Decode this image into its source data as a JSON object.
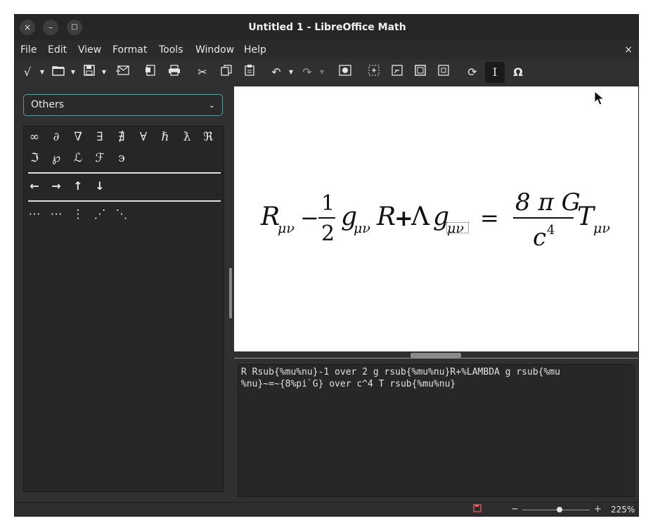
{
  "window": {
    "title": "Untitled 1 - LibreOffice Math",
    "close_glyph": "×",
    "minimize_glyph": "–",
    "maximize_glyph": "□"
  },
  "menubar": {
    "items": [
      "File",
      "Edit",
      "View",
      "Format",
      "Tools",
      "Window",
      "Help"
    ],
    "close_glyph": "×"
  },
  "toolbar": {
    "icons": [
      "formula-cursor-icon",
      "open-icon",
      "save-icon",
      "export-icon",
      "export-pdf-icon",
      "print-icon",
      "cut-icon",
      "copy-icon",
      "paste-icon",
      "undo-icon",
      "redo-icon",
      "zoom-100-icon",
      "zoom-in-icon",
      "zoom-out-icon",
      "show-all-icon",
      "shrink-icon",
      "update-icon",
      "formula-cursor-toggle-icon",
      "symbols-icon"
    ]
  },
  "elements_panel": {
    "category": "Others",
    "others_row1": [
      "∞",
      "∂",
      "∇",
      "∃",
      "∄",
      "∀",
      "ℏ",
      "ƛ",
      "ℜ"
    ],
    "others_row2": [
      "ℑ",
      "℘",
      "ℒ",
      "ℱ",
      "϶"
    ],
    "arrows": [
      "←",
      "→",
      "↑",
      "↓"
    ],
    "dots": [
      "⋯",
      "⋯",
      "⋮",
      "⋰",
      "⋱"
    ]
  },
  "formula_preview": {
    "R": "R",
    "sub_mu_nu": "μν",
    "minus": "−",
    "one": "1",
    "two": "2",
    "g": "g",
    "plus": "+",
    "lambda": "Λ",
    "equals": "=",
    "eight_pi_g": "8 π G",
    "c": "c",
    "four": "4",
    "T": "T"
  },
  "editor": {
    "line1": "R Rsub{%mu%nu}-1 over 2 g rsub{%mu%nu}R+%LAMBDA g rsub{%mu",
    "line2": "%nu}~=~{8%pi`G} over c^4 T rsub{%mu%nu}"
  },
  "statusbar": {
    "zoom_minus": "−",
    "zoom_plus": "+",
    "zoom_label": "225%",
    "zoom_level": 0.55
  },
  "colors": {
    "window_bg": "#303030",
    "titlebar_bg": "#262626",
    "dropdown_border": "#5a9a9a",
    "save_indicator": "#e06060"
  }
}
